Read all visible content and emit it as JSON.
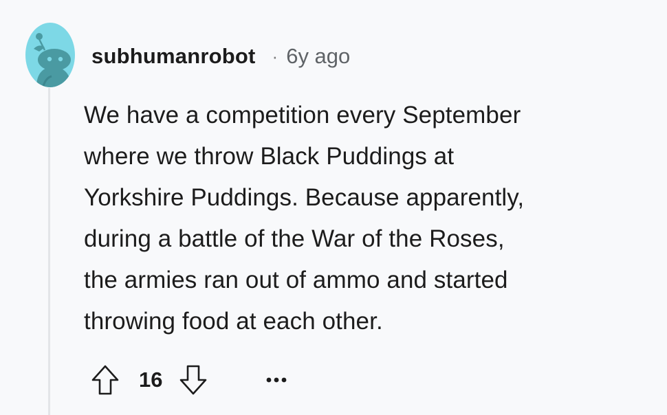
{
  "comment": {
    "username": "subhumanrobot",
    "separator": "·",
    "timestamp": "6y ago",
    "body_lines": [
      "We have a competition every September",
      "where we throw Black Puddings at",
      "Yorkshire Puddings. Because apparently,",
      "during a battle of the War of the Roses,",
      "the armies ran out of ammo and started",
      "throwing food at each other."
    ],
    "score": "16"
  },
  "icons": {
    "avatar": "snoo-avatar-icon",
    "upvote": "upvote-arrow-icon",
    "downvote": "downvote-arrow-icon",
    "more": "more-options-icon"
  },
  "colors": {
    "background": "#f8f9fb",
    "avatar_bg": "#7dd8e6",
    "avatar_figure": "#4a9aa2",
    "thread_line": "#e3e5e8",
    "text": "#1c1c1c",
    "muted": "#5f6367"
  }
}
